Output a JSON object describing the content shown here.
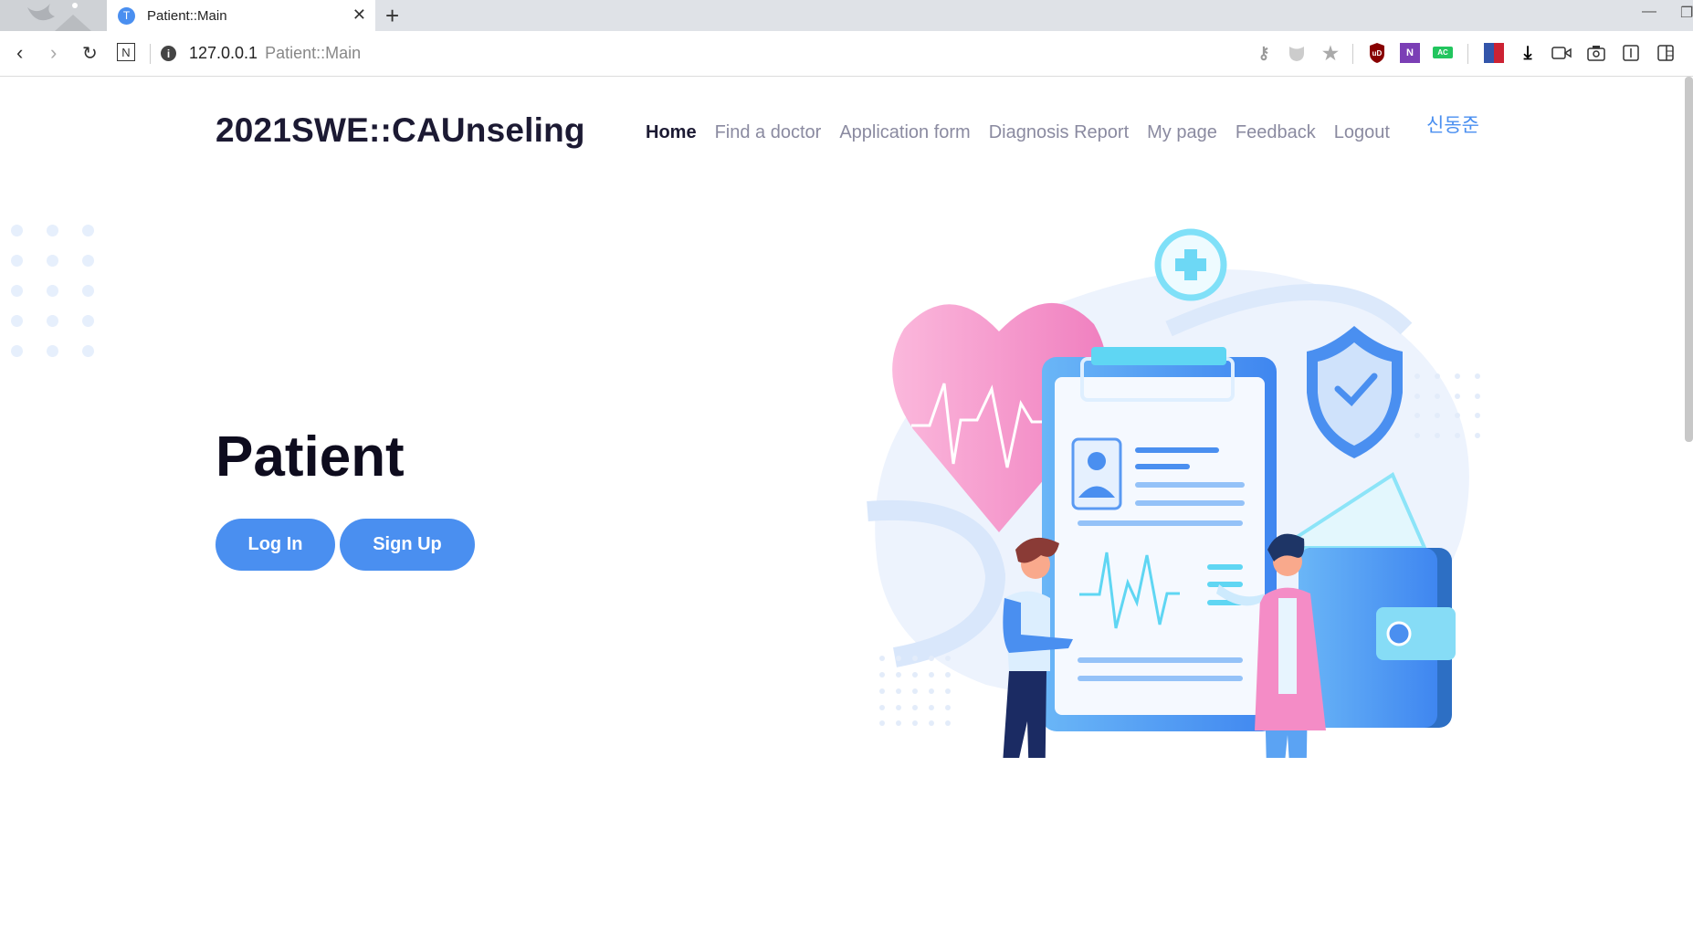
{
  "browser": {
    "tab_title": "Patient::Main",
    "tab_favicon": "T",
    "url_host": "127.0.0.1",
    "url_path": "Patient::Main",
    "extensions": [
      "key-icon",
      "shield-ext-icon",
      "star-icon",
      "ublock-icon",
      "onenote-icon",
      "ac-icon",
      "translate-icon",
      "download-icon",
      "video-icon",
      "camera-icon",
      "reader-icon",
      "sidebar-icon"
    ]
  },
  "header": {
    "brand": "2021SWE::CAUnseling",
    "nav": [
      {
        "label": "Home",
        "active": true
      },
      {
        "label": "Find a doctor"
      },
      {
        "label": "Application form"
      },
      {
        "label": "Diagnosis Report"
      },
      {
        "label": "My page"
      },
      {
        "label": "Feedback"
      },
      {
        "label": "Logout"
      }
    ],
    "user_name": "신동준"
  },
  "hero": {
    "title": "Patient",
    "login_label": "Log In",
    "signup_label": "Sign Up"
  },
  "colors": {
    "accent": "#4a8ff0",
    "brand_text": "#1c1a33",
    "nav_text": "#8a8aa0"
  }
}
